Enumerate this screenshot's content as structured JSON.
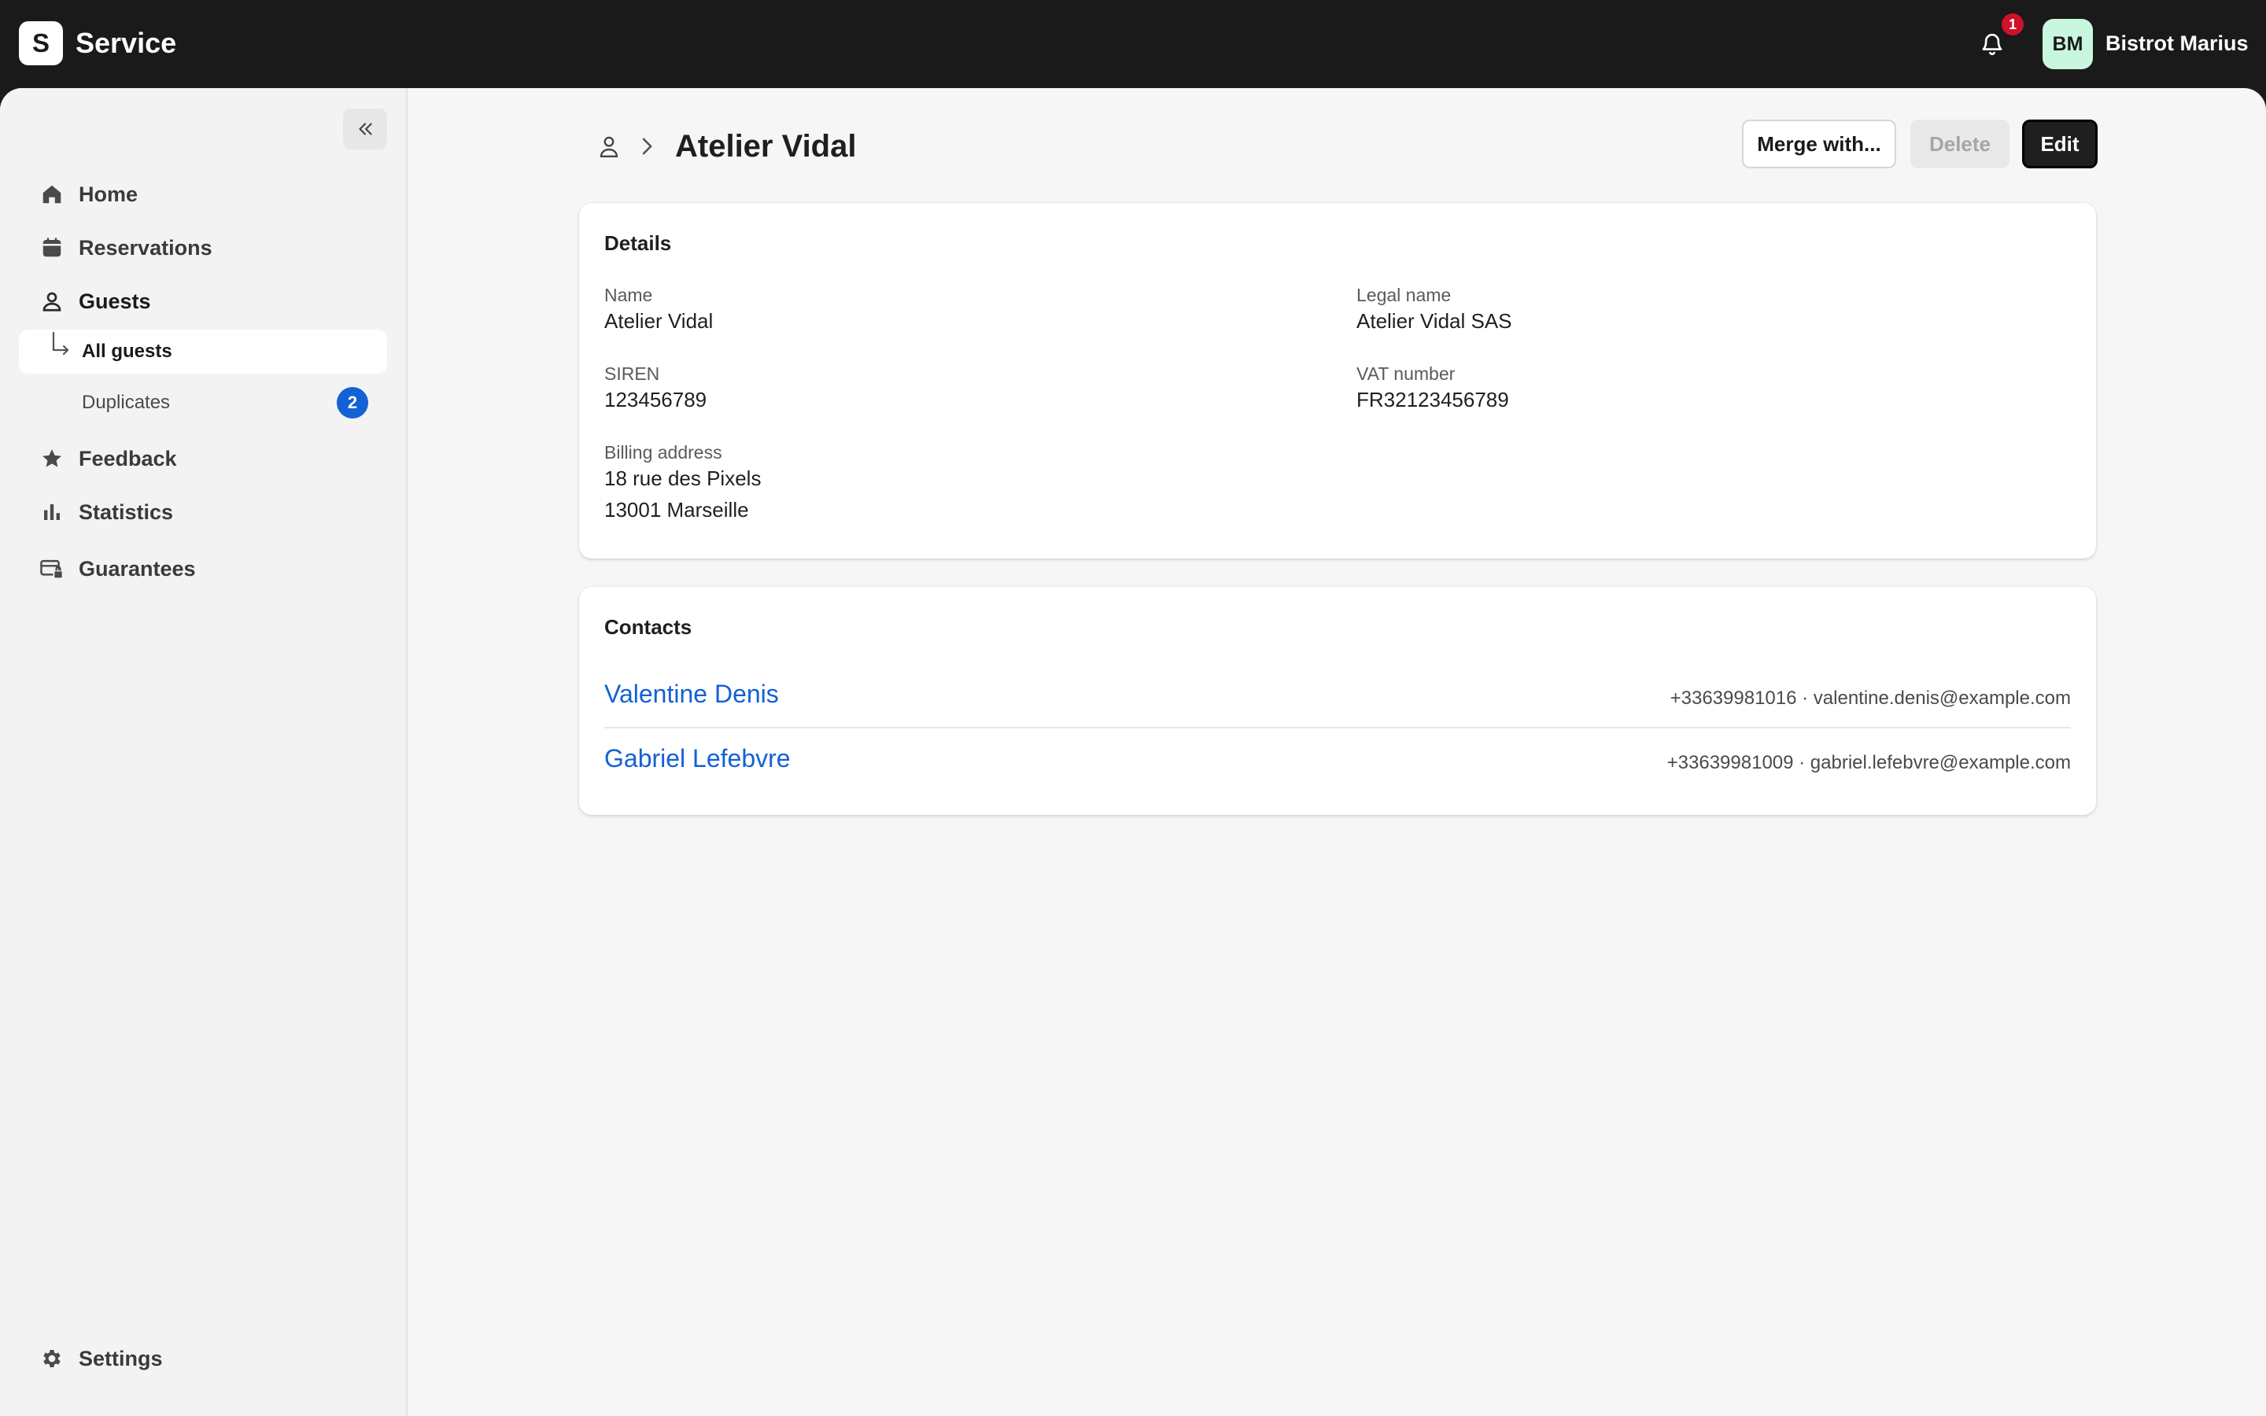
{
  "app": {
    "logo_letter": "S",
    "title": "Service"
  },
  "topbar": {
    "notification_count": "1",
    "user_initials": "BM",
    "user_name": "Bistrot Marius"
  },
  "sidebar": {
    "items": [
      {
        "label": "Home",
        "icon": "home-icon"
      },
      {
        "label": "Reservations",
        "icon": "calendar-icon"
      },
      {
        "label": "Guests",
        "icon": "user-icon"
      },
      {
        "label": "Feedback",
        "icon": "star-icon"
      },
      {
        "label": "Statistics",
        "icon": "bar-chart-icon"
      },
      {
        "label": "Guarantees",
        "icon": "card-lock-icon"
      }
    ],
    "sub_items": [
      {
        "label": "All guests",
        "active": true
      },
      {
        "label": "Duplicates",
        "badge": "2"
      }
    ],
    "settings_label": "Settings"
  },
  "header": {
    "title": "Atelier Vidal",
    "buttons": {
      "merge": "Merge with...",
      "delete": "Delete",
      "edit": "Edit"
    }
  },
  "details": {
    "title": "Details",
    "name_label": "Name",
    "name_value": "Atelier Vidal",
    "legal_label": "Legal name",
    "legal_value": "Atelier Vidal SAS",
    "siren_label": "SIREN",
    "siren_value": "123456789",
    "vat_label": "VAT number",
    "vat_value": "FR32123456789",
    "billing_label": "Billing address",
    "billing_line1": "18 rue des Pixels",
    "billing_line2": "13001 Marseille"
  },
  "contacts": {
    "title": "Contacts",
    "rows": [
      {
        "name": "Valentine Denis",
        "meta": "+33639981016 · valentine.denis@example.com"
      },
      {
        "name": "Gabriel Lefebvre",
        "meta": "+33639981009 · gabriel.lefebvre@example.com"
      }
    ]
  },
  "colors": {
    "accent": "#1261d6",
    "topbar": "#1a1a1a",
    "notification": "#d0112b",
    "avatar": "#c9f6df"
  }
}
